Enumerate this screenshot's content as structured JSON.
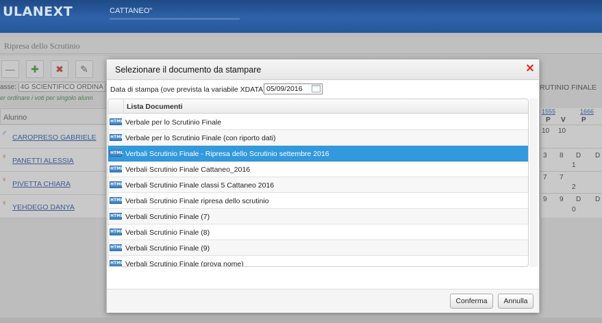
{
  "app": {
    "brand": "ULANEXT",
    "school": "CATTANEO\""
  },
  "page": {
    "title": "Ripresa dello Scrutinio"
  },
  "background": {
    "class_label": "asse:",
    "class_value": "4G SCIENTIFICO ORDINA",
    "hint": "er ordinare i voti per singolo alunn",
    "alunno_header": "Alunno",
    "right_header": "RUTINIO FINALE",
    "students": [
      {
        "name": "CAROPRESO GABRIELE",
        "gender": "male"
      },
      {
        "name": "PANETTI ALESSIA",
        "gender": "female"
      },
      {
        "name": "PIVETTA CHIARA",
        "gender": "female"
      },
      {
        "name": "YEHDEGO DANYA",
        "gender": "female"
      }
    ],
    "grid": {
      "col_codes": [
        "1555",
        "1666"
      ],
      "subheads": [
        "P",
        "V",
        "P"
      ],
      "cells": [
        "10",
        "10",
        "3",
        "8",
        "D",
        "D",
        "1",
        "7",
        "7",
        "2",
        "9",
        "9",
        "D",
        "D",
        "0"
      ]
    }
  },
  "dialog": {
    "title": "Selezionare il documento da stampare",
    "date_label": "Data di stampa (ove prevista la variabile XDATA):",
    "date_value": "05/09/2016",
    "list_header": "Lista Documenti",
    "icon_text": "HTML",
    "selected_index": 2,
    "documents": [
      "Verbale per lo Scrutinio Finale",
      "Verbale per lo Scrutinio Finale (con riporto dati)",
      "Verbali Scrutinio Finale - Ripresa dello Scrutinio settembre 2016",
      "Verbali Scrutinio Finale Cattaneo_2016",
      "Verbali Scrutinio Finale classi 5 Cattaneo 2016",
      "Verbali Scrutinio Finale ripresa dello scrutinio",
      "Verbali Scrutinio Finale (7)",
      "Verbali Scrutinio Finale (8)",
      "Verbali Scrutinio Finale (9)",
      "Verbali Scrutinio Finale (prova nome)"
    ],
    "confirm_label": "Conferma",
    "cancel_label": "Annulla"
  },
  "colors": {
    "topbar": "#2e62a8",
    "selection": "#3399dd",
    "close": "#e2281f",
    "link": "#2455a8"
  }
}
